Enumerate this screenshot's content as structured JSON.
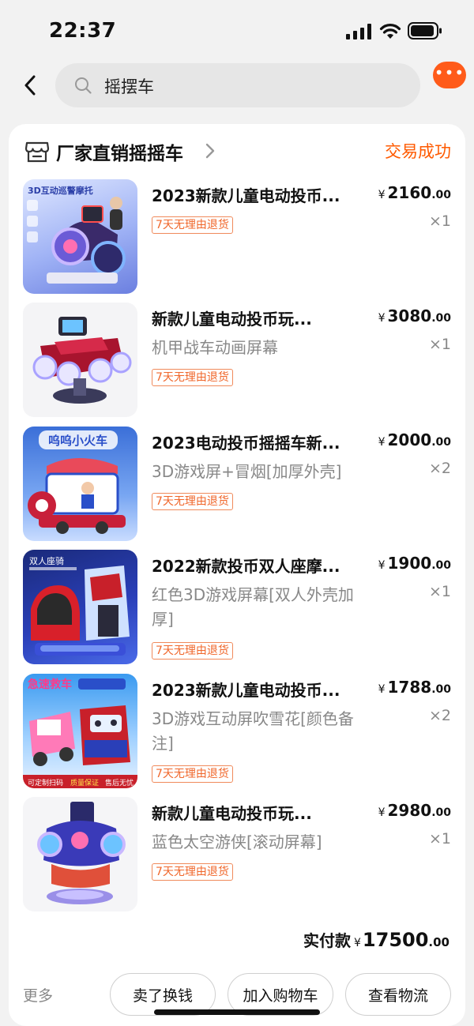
{
  "status_bar": {
    "time": "22:37"
  },
  "header": {
    "search_text": "摇摆车",
    "more_dots": "•••"
  },
  "order": {
    "shop_name": "厂家直销摇摇车",
    "status": "交易成功",
    "items": [
      {
        "title": "2023新款儿童电动投币...",
        "price_int": "2160",
        "price_dec": ".00",
        "variant": "",
        "qty": "×1",
        "return_policy": "7天无理由退货",
        "thumb_text": "3D互动巡警摩托"
      },
      {
        "title": "新款儿童电动投币玩...",
        "price_int": "3080",
        "price_dec": ".00",
        "variant": "机甲战车动画屏幕",
        "qty": "×1",
        "return_policy": "7天无理由退货",
        "thumb_text": ""
      },
      {
        "title": "2023电动投币摇摇车新...",
        "price_int": "2000",
        "price_dec": ".00",
        "variant": "3D游戏屏+冒烟[加厚外壳]",
        "qty": "×2",
        "return_policy": "7天无理由退货",
        "thumb_text": "呜呜小火车"
      },
      {
        "title": "2022新款投币双人座摩...",
        "price_int": "1900",
        "price_dec": ".00",
        "variant": "红色3D游戏屏幕[双人外壳加厚]",
        "qty": "×1",
        "return_policy": "7天无理由退货",
        "thumb_text": "双人座骑"
      },
      {
        "title": "2023新款儿童电动投币...",
        "price_int": "1788",
        "price_dec": ".00",
        "variant": "3D游戏互动屏吹雪花[颜色备注]",
        "qty": "×2",
        "return_policy": "7天无理由退货",
        "thumb_text": "急速救车"
      },
      {
        "title": "新款儿童电动投币玩...",
        "price_int": "2980",
        "price_dec": ".00",
        "variant": "蓝色太空游侠[滚动屏幕]",
        "qty": "×1",
        "return_policy": "7天无理由退货",
        "thumb_text": ""
      }
    ],
    "currency": "¥",
    "total_label": "实付款",
    "total_int": "17500",
    "total_dec": ".00"
  },
  "actions": {
    "more": "更多",
    "sell": "卖了换钱",
    "add_cart": "加入购物车",
    "logistics": "查看物流"
  },
  "colors": {
    "accent": "#ff5a00",
    "badge": "#f0662a",
    "background": "#f2f2f2"
  },
  "icons": [
    "back-arrow-icon",
    "search-icon",
    "shop-icon",
    "chevron-right-icon",
    "signal-icon",
    "wifi-icon",
    "battery-icon"
  ]
}
